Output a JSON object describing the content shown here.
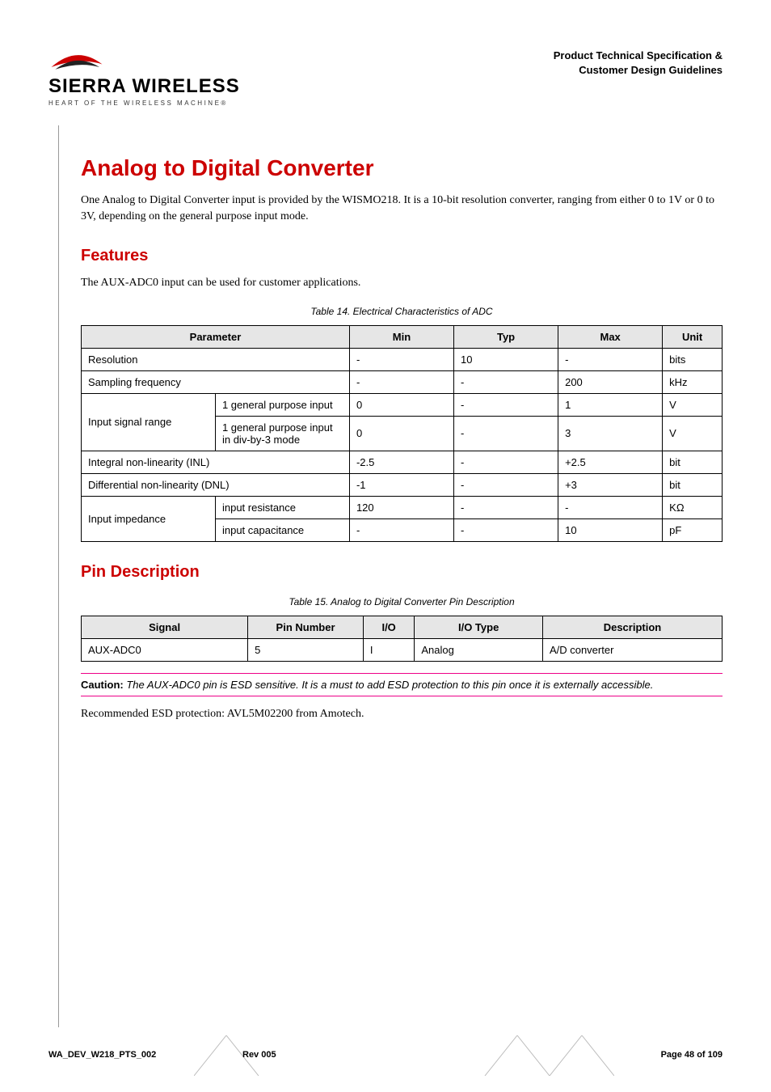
{
  "header": {
    "logo_main": "SIERRA WIRELESS",
    "logo_tag": "HEART OF THE WIRELESS MACHINE®",
    "right_line1": "Product Technical Specification &",
    "right_line2": "Customer Design Guidelines"
  },
  "title": "Analog to Digital Converter",
  "intro": "One Analog to Digital Converter input is provided by the WISMO218. It is a 10-bit resolution converter, ranging from either 0 to 1V or 0 to 3V, depending on the general purpose input mode.",
  "features": {
    "heading": "Features",
    "text": "The AUX-ADC0 input can be used for customer applications.",
    "table_caption": "Table 14.    Electrical Characteristics of ADC",
    "columns": {
      "param": "Parameter",
      "min": "Min",
      "typ": "Typ",
      "max": "Max",
      "unit": "Unit"
    },
    "rows": {
      "resolution": {
        "label": "Resolution",
        "min": "-",
        "typ": "10",
        "max": "-",
        "unit": "bits"
      },
      "sampling": {
        "label": "Sampling frequency",
        "min": "-",
        "typ": "-",
        "max": "200",
        "unit": "kHz"
      },
      "isr_group": "Input signal range",
      "isr1": {
        "sub": "1 general purpose input",
        "min": "0",
        "typ": "-",
        "max": "1",
        "unit": "V"
      },
      "isr2": {
        "sub": "1 general purpose input in div-by-3 mode",
        "min": "0",
        "typ": "-",
        "max": "3",
        "unit": "V"
      },
      "inl": {
        "label": "Integral non-linearity (INL)",
        "min": "-2.5",
        "typ": "-",
        "max": "+2.5",
        "unit": "bit"
      },
      "dnl": {
        "label": "Differential non-linearity (DNL)",
        "min": "-1",
        "typ": "-",
        "max": "+3",
        "unit": "bit"
      },
      "imp_group": "Input impedance",
      "imp1": {
        "sub": "input resistance",
        "min": "120",
        "typ": "-",
        "max": "-",
        "unit": "KΩ"
      },
      "imp2": {
        "sub": "input capacitance",
        "min": "-",
        "typ": "-",
        "max": "10",
        "unit": "pF"
      }
    }
  },
  "pin": {
    "heading": "Pin Description",
    "table_caption": "Table 15.    Analog to Digital Converter Pin Description",
    "columns": {
      "signal": "Signal",
      "pinnum": "Pin Number",
      "io": "I/O",
      "iotype": "I/O Type",
      "desc": "Description"
    },
    "row": {
      "signal": "AUX-ADC0",
      "pinnum": "5",
      "io": "I",
      "iotype": "Analog",
      "desc": "A/D converter"
    }
  },
  "caution": {
    "label": "Caution:",
    "text": "The AUX-ADC0 pin is ESD sensitive. It is a must to add ESD protection to this pin once it is externally accessible."
  },
  "recommended": "Recommended ESD protection: AVL5M02200 from Amotech.",
  "footer": {
    "left": "WA_DEV_W218_PTS_002",
    "mid": "Rev 005",
    "right": "Page 48 of 109"
  },
  "chart_data": {
    "type": "table",
    "title": "Electrical Characteristics of ADC",
    "columns": [
      "Parameter",
      "Min",
      "Typ",
      "Max",
      "Unit"
    ],
    "rows": [
      [
        "Resolution",
        null,
        10,
        null,
        "bits"
      ],
      [
        "Sampling frequency",
        null,
        null,
        200,
        "kHz"
      ],
      [
        "Input signal range — 1 general purpose input",
        0,
        null,
        1,
        "V"
      ],
      [
        "Input signal range — 1 general purpose input in div-by-3 mode",
        0,
        null,
        3,
        "V"
      ],
      [
        "Integral non-linearity (INL)",
        -2.5,
        null,
        2.5,
        "bit"
      ],
      [
        "Differential non-linearity (DNL)",
        -1,
        null,
        3,
        "bit"
      ],
      [
        "Input impedance — input resistance",
        120,
        null,
        null,
        "KΩ"
      ],
      [
        "Input impedance — input capacitance",
        null,
        null,
        10,
        "pF"
      ]
    ]
  }
}
